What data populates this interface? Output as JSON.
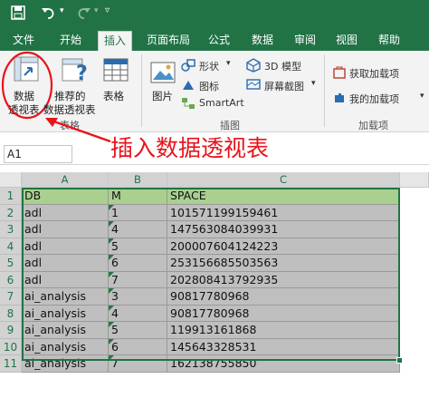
{
  "tabs": [
    "文件",
    "开始",
    "插入",
    "页面布局",
    "公式",
    "数据",
    "审阅",
    "视图",
    "帮助"
  ],
  "active_tab": "插入",
  "ribbon": {
    "pivot_label_1": "数据",
    "pivot_label_2": "透视表",
    "recommended_label_1": "推荐的",
    "recommended_label_2": "数据透视表",
    "table_label": "表格",
    "group_tables": "表格",
    "pictures_label": "图片",
    "shapes_label": "形状",
    "icons_label": "图标",
    "smartart_label": "SmartArt",
    "model3d_label": "3D 模型",
    "screenshot_label": "屏幕截图",
    "group_illustrations": "插图",
    "get_addins_label": "获取加载项",
    "my_addins_label": "我的加载项",
    "group_addins": "加载项"
  },
  "annotation": "插入数据透视表",
  "name_box": "A1",
  "columns": [
    "A",
    "B",
    "C"
  ],
  "rows": [
    "1",
    "2",
    "3",
    "4",
    "5",
    "6",
    "7",
    "8",
    "9",
    "10",
    "11"
  ],
  "table": {
    "headers": [
      "DB",
      "M",
      "SPACE"
    ],
    "data": [
      [
        "adl",
        "1",
        "101571199159461"
      ],
      [
        "adl",
        "4",
        "147563084039931"
      ],
      [
        "adl",
        "5",
        "200007604124223"
      ],
      [
        "adl",
        "6",
        "253156685503563"
      ],
      [
        "adl",
        "7",
        "202808413792935"
      ],
      [
        "ai_analysis",
        "3",
        "90817780968"
      ],
      [
        "ai_analysis",
        "4",
        "90817780968"
      ],
      [
        "ai_analysis",
        "5",
        "119913161868"
      ],
      [
        "ai_analysis",
        "6",
        "145643328531"
      ],
      [
        "ai_analysis",
        "7",
        "162138755850"
      ]
    ]
  },
  "colors": {
    "excel_green": "#217346",
    "header_fill": "#a9d08e",
    "data_fill": "#bfbfbf",
    "annotation_red": "#e8141b"
  },
  "icons": [
    "save-icon",
    "undo-icon",
    "redo-icon",
    "customize-icon",
    "pivot-table-icon",
    "recommended-pivot-icon",
    "table-icon",
    "pictures-icon",
    "shapes-icon",
    "icons-icon",
    "smartart-icon",
    "3d-model-icon",
    "screenshot-icon",
    "get-addins-icon",
    "my-addins-icon"
  ]
}
